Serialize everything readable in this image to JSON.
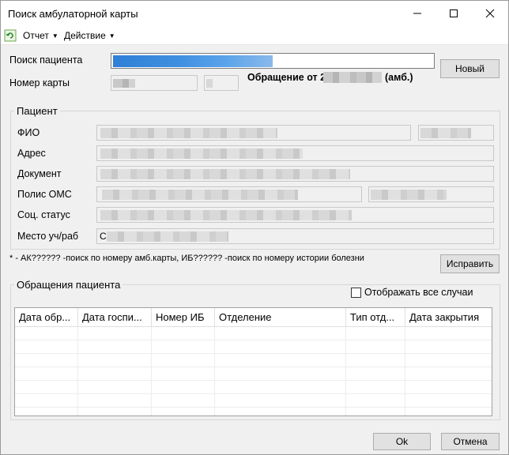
{
  "window": {
    "title": "Поиск амбулаторной карты"
  },
  "menu": {
    "report": "Отчет",
    "action": "Действие"
  },
  "search": {
    "patient_label": "Поиск пациента",
    "card_label": "Номер карты",
    "card_value_1": "2792",
    "card_value_2": "1",
    "appeal_text": "Обращение от 2",
    "appeal_suffix": "(амб.)",
    "new_button": "Новый"
  },
  "patient": {
    "group_title": "Пациент",
    "fio_label": "ФИО",
    "address_label": "Адрес",
    "document_label": "Документ",
    "policy_label": "Полис ОМС",
    "social_label": "Соц. статус",
    "work_label": "Место уч/раб",
    "work_value_prefix": "С",
    "hint": "* - АК?????? -поиск по номеру амб.карты, ИБ?????? -поиск по номеру истории болезни",
    "fix_button": "Исправить"
  },
  "appeals": {
    "group_title": "Обращения пациента",
    "show_all_label": "Отображать все случаи",
    "show_all_checked": false,
    "columns": [
      "Дата обр...",
      "Дата госпи...",
      "Номер ИБ",
      "Отделение",
      "Тип отд...",
      "Дата закрытия"
    ]
  },
  "footer": {
    "ok": "Ok",
    "cancel": "Отмена"
  }
}
